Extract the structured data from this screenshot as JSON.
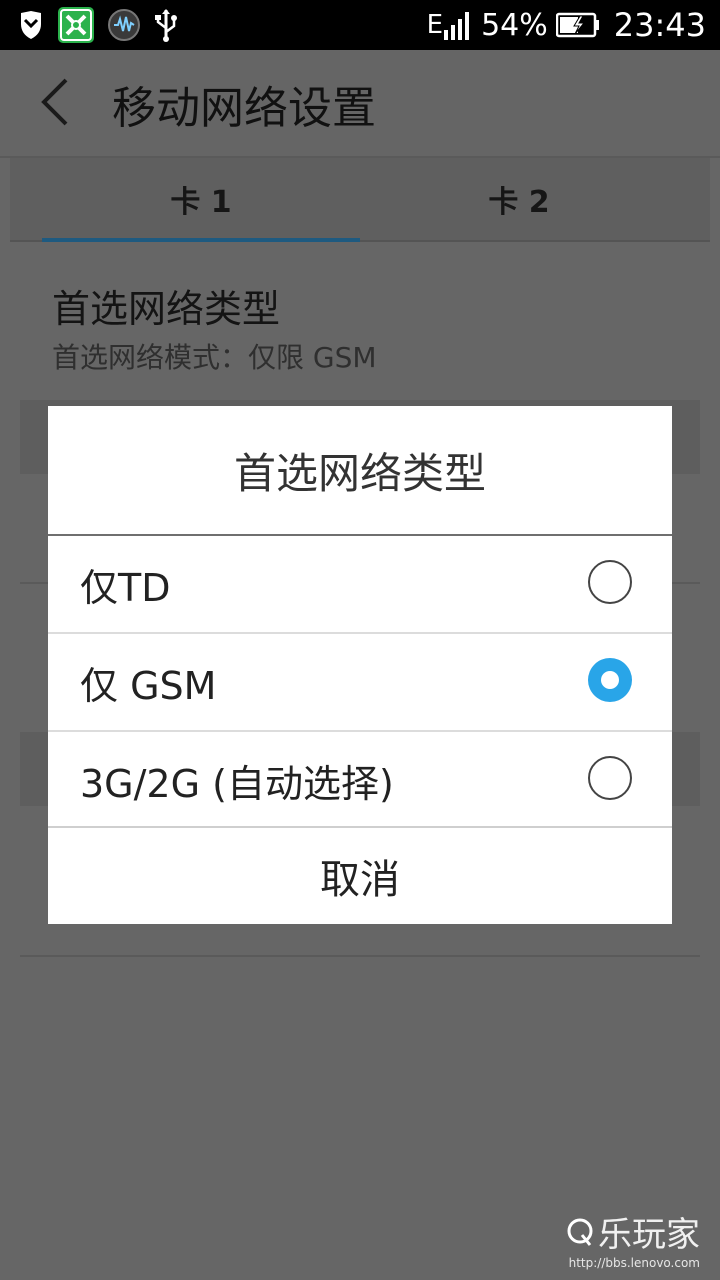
{
  "status_bar": {
    "signal_label": "E",
    "battery_percent": "54%",
    "time": "23:43",
    "icons": [
      "shield-icon",
      "app-badge-icon",
      "audio-wave-icon",
      "usb-icon",
      "signal-icon",
      "battery-icon"
    ],
    "colors": {
      "app_badge": "#2bb24c"
    }
  },
  "header": {
    "title": "移动网络设置",
    "back_icon": "chevron-left-icon"
  },
  "tabs": [
    {
      "label": "卡 1",
      "selected": true
    },
    {
      "label": "卡 2",
      "selected": false
    }
  ],
  "settings": {
    "preferred_network": {
      "title": "首选网络类型",
      "summary": "首选网络模式：仅限 GSM"
    }
  },
  "dialog": {
    "title": "首选网络类型",
    "options": [
      {
        "label": "仅TD",
        "selected": false
      },
      {
        "label": "仅 GSM",
        "selected": true
      },
      {
        "label": "3G/2G (自动选择)",
        "selected": false
      }
    ],
    "cancel_label": "取消",
    "accent_color": "#29a5e8"
  },
  "watermark": {
    "brand": "乐玩家",
    "url": "http://bbs.lenovo.com"
  }
}
